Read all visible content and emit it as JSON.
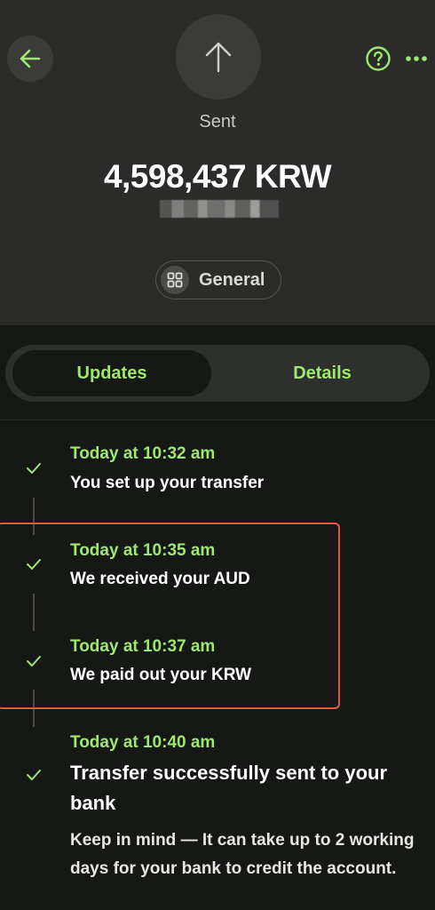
{
  "header": {
    "status": "Sent",
    "amount": "4,598,437 KRW",
    "category": "General",
    "accent_color": "#9fe870"
  },
  "icons": {
    "back": "arrow-left-icon",
    "hero": "arrow-up-icon",
    "help": "question-circle-icon",
    "more": "more-dots-icon",
    "category": "grid-icon",
    "check": "check-icon"
  },
  "tabs": [
    {
      "label": "Updates",
      "selected": true
    },
    {
      "label": "Details",
      "selected": false
    }
  ],
  "timeline": [
    {
      "time": "Today at 10:32 am",
      "title": "You set up your transfer"
    },
    {
      "time": "Today at 10:35 am",
      "title": "We received your AUD"
    },
    {
      "time": "Today at 10:37 am",
      "title": "We paid out your KRW"
    },
    {
      "time": "Today at 10:40 am",
      "title": "Transfer successfully sent to your bank",
      "note": "Keep in mind — It can take up to 2 working days for your bank to credit the account."
    }
  ]
}
